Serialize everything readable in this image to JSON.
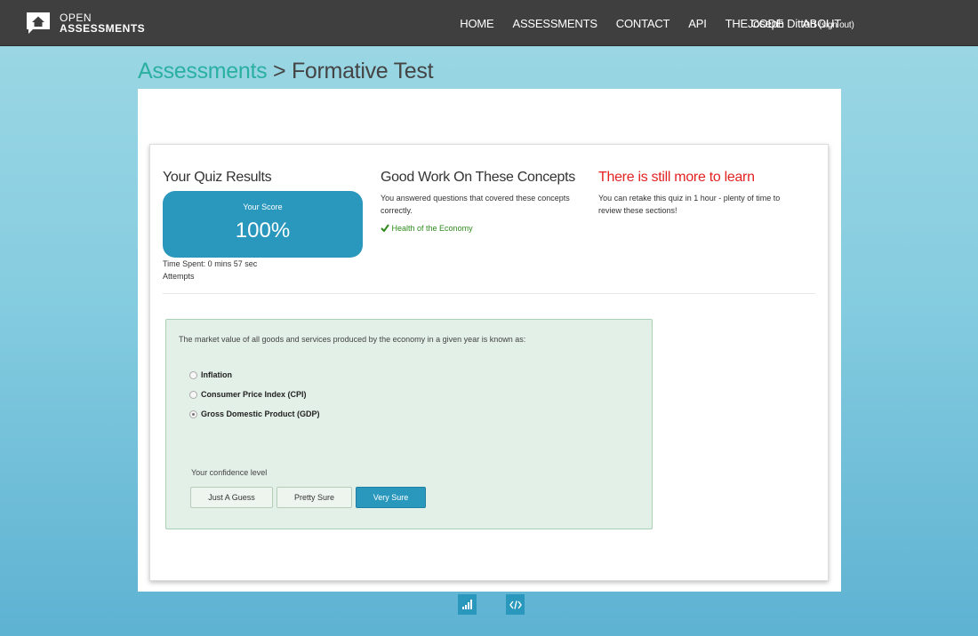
{
  "brand": {
    "line1": "OPEN",
    "line2": "ASSESSMENTS"
  },
  "nav": {
    "items": [
      "HOME",
      "ASSESSMENTS",
      "CONTACT",
      "API",
      "THE CODE",
      "ABOUT"
    ],
    "user": "Joseph Ditton",
    "signout": "(sign out)"
  },
  "heading": {
    "crumb": "Assessments",
    "separator": " > ",
    "title": "Formative Test"
  },
  "results": {
    "title": "Your Quiz Results",
    "score_label": "Your Score",
    "score_value": "100%",
    "time_spent": "Time Spent: 0 mins 57 sec",
    "attempts": "Attempts"
  },
  "good_work": {
    "title": "Good Work On These Concepts",
    "text": "You answered questions that covered these concepts correctly.",
    "concept": "Health of the Economy"
  },
  "more_to_learn": {
    "title": "There is still more to learn",
    "text": "You can retake this quiz in 1 hour - plenty of time to review these sections!"
  },
  "question": {
    "text": "The market value of all goods and services produced by the economy in a given year is known as:",
    "options": [
      {
        "label": "Inflation",
        "selected": false
      },
      {
        "label": "Consumer Price Index (CPI)",
        "selected": false
      },
      {
        "label": "Gross Domestic Product (GDP)",
        "selected": true
      }
    ],
    "confidence_label": "Your confidence level",
    "confidence_buttons": [
      "Just A Guess",
      "Pretty Sure",
      "Very Sure"
    ],
    "confidence_selected": "Very Sure"
  },
  "colors": {
    "accent": "#2a97bd",
    "crumb": "#2ab0a0",
    "success": "#2e8a1c",
    "alert": "#e32222",
    "navbar": "#3f3f3f"
  },
  "footer_icons": [
    "stats-icon",
    "embed-code-icon"
  ]
}
